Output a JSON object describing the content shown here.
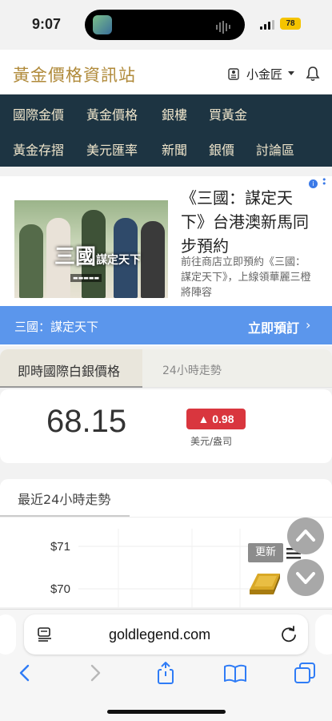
{
  "status_bar": {
    "time": "9:07",
    "battery": "78"
  },
  "header": {
    "site_title": "黃金價格資訊站",
    "user_name": "小金匠"
  },
  "nav": {
    "items": [
      "國際金價",
      "黃金價格",
      "銀樓",
      "買黃金",
      "黃金存摺",
      "美元匯率",
      "新聞",
      "銀價",
      "討論區"
    ]
  },
  "ad": {
    "headline": "《三國：謀定天下》台港澳新馬同步預約",
    "description": "前往商店立即預約《三國：謀定天下》，上線領華麗三橙將陣容",
    "logo_text": "三國謀定天下",
    "bar_name": "三國：謀定天下",
    "cta": "立即預訂"
  },
  "tabs": {
    "active": "即時國際白銀價格",
    "other": "24小時走勢"
  },
  "price": {
    "value": "68.15",
    "change": "▲ 0.98",
    "unit": "美元/盎司",
    "change_color": "#d9363e"
  },
  "trend": {
    "title": "最近24小時走勢",
    "update_label": "更新"
  },
  "chart_data": {
    "type": "line",
    "y_ticks": [
      "$71",
      "$70"
    ],
    "series": []
  },
  "browser": {
    "url": "goldlegend.com"
  },
  "colors": {
    "nav_bg": "#1d3442",
    "title_gold": "#b08a3a",
    "ad_bar": "#5b96ec"
  }
}
